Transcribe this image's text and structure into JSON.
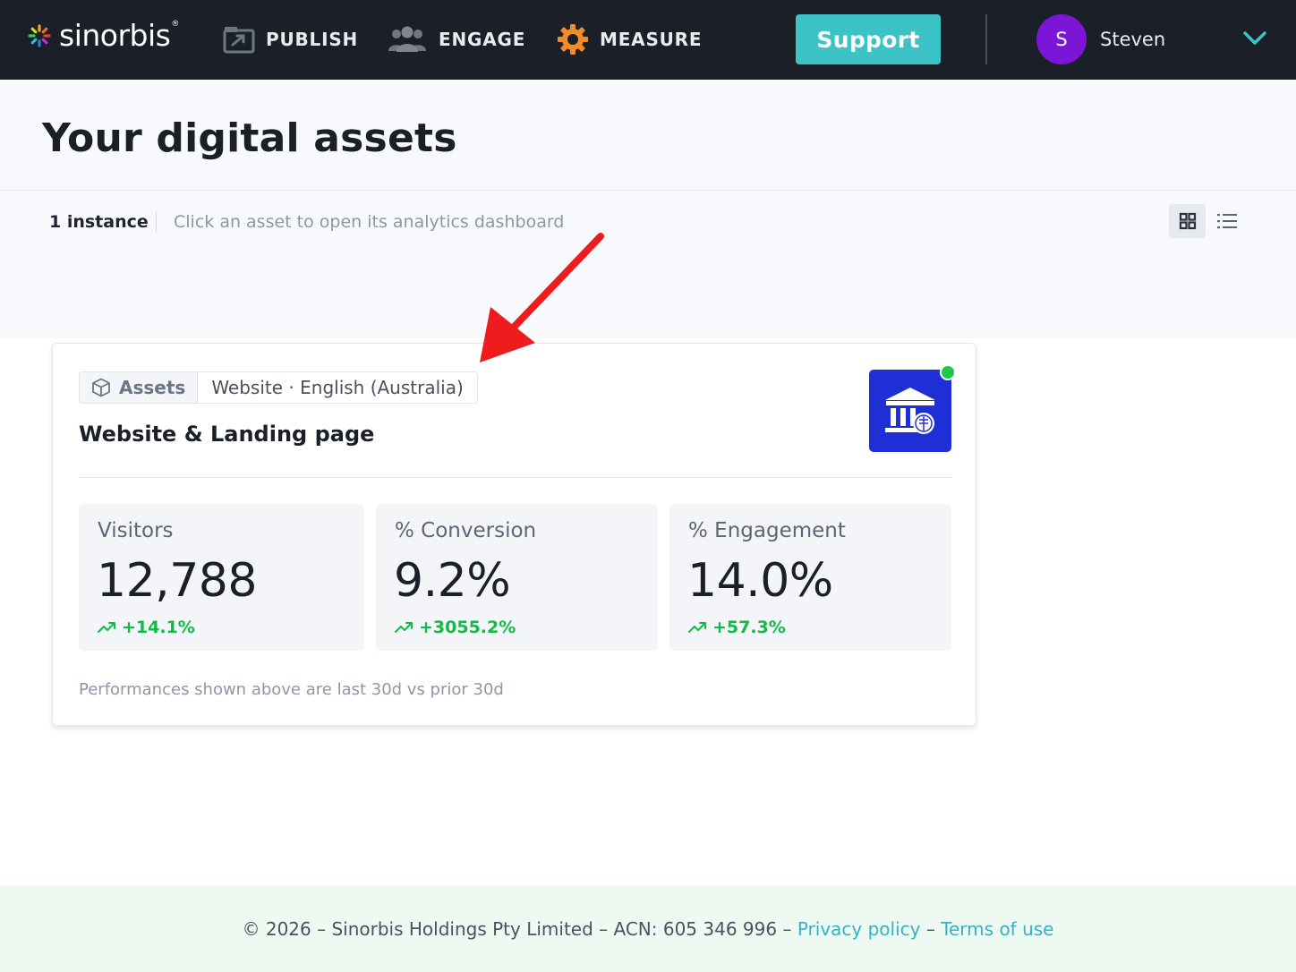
{
  "app": {
    "brand": "sinorbis",
    "brand_mark": "®"
  },
  "nav": {
    "items": [
      {
        "label": "PUBLISH",
        "icon": "publish-icon"
      },
      {
        "label": "ENGAGE",
        "icon": "people-icon"
      },
      {
        "label": "MEASURE",
        "icon": "gear-icon"
      }
    ],
    "support_label": "Support",
    "user": {
      "initial": "S",
      "name": "Steven"
    }
  },
  "page": {
    "title": "Your digital assets",
    "instance_count": "1 instance",
    "hint": "Click an asset to open its analytics dashboard"
  },
  "card": {
    "tag_type": "Assets",
    "tag_detail": "Website · English (Australia)",
    "title": "Website & Landing page",
    "status": "online",
    "metrics": [
      {
        "label": "Visitors",
        "value": "12,788",
        "change": "+14.1%"
      },
      {
        "label": "% Conversion",
        "value": "9.2%",
        "change": "+3055.2%"
      },
      {
        "label": "% Engagement",
        "value": "14.0%",
        "change": "+57.3%"
      }
    ],
    "footnote": "Performances shown above are last 30d vs prior 30d"
  },
  "footer": {
    "copyright": "© 2026 – Sinorbis Holdings Pty Limited – ACN: 605 346 996 – ",
    "privacy": "Privacy policy",
    "sep": " – ",
    "terms": "Terms of use"
  },
  "colors": {
    "nav_bg": "#1b1f27",
    "accent": "#3cc3c6",
    "avatar": "#7b16d6",
    "positive": "#16b84a",
    "asset_logo_bg": "#1f2fd6",
    "annotation_arrow": "#ee1c1c"
  }
}
